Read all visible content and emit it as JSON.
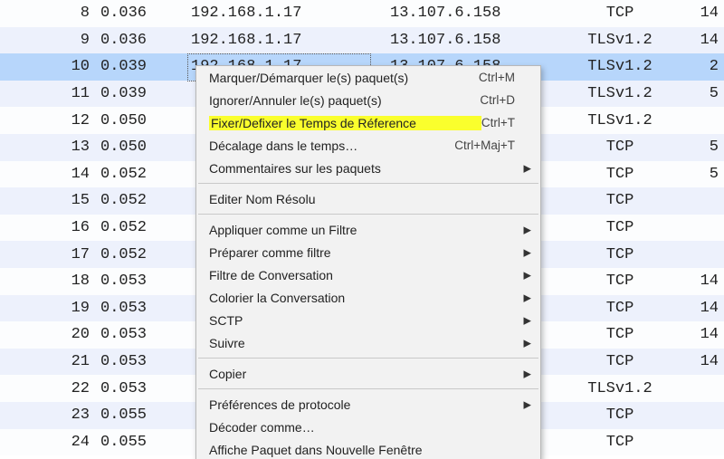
{
  "packets": [
    {
      "no": "8",
      "time": "0.036",
      "src": "192.168.1.17",
      "dst": "13.107.6.158",
      "proto": "TCP",
      "len": "14"
    },
    {
      "no": "9",
      "time": "0.036",
      "src": "192.168.1.17",
      "dst": "13.107.6.158",
      "proto": "TLSv1.2",
      "len": "14"
    },
    {
      "no": "10",
      "time": "0.039",
      "src": "192.168.1.17",
      "dst": "13.107.6.158",
      "proto": "TLSv1.2",
      "len": "2",
      "selected": true
    },
    {
      "no": "11",
      "time": "0.039",
      "src": "",
      "dst": "",
      "proto": "TLSv1.2",
      "len": "5"
    },
    {
      "no": "12",
      "time": "0.050",
      "src": "",
      "dst": "",
      "proto": "TLSv1.2",
      "len": ""
    },
    {
      "no": "13",
      "time": "0.050",
      "src": "",
      "dst": "",
      "proto": "TCP",
      "len": "5"
    },
    {
      "no": "14",
      "time": "0.052",
      "src": "",
      "dst": "",
      "proto": "TCP",
      "len": "5"
    },
    {
      "no": "15",
      "time": "0.052",
      "src": "",
      "dst": "",
      "proto": "TCP",
      "len": ""
    },
    {
      "no": "16",
      "time": "0.052",
      "src": "",
      "dst": "",
      "proto": "TCP",
      "len": ""
    },
    {
      "no": "17",
      "time": "0.052",
      "src": "",
      "dst": "",
      "proto": "TCP",
      "len": ""
    },
    {
      "no": "18",
      "time": "0.053",
      "src": "",
      "dst": "",
      "proto": "TCP",
      "len": "14"
    },
    {
      "no": "19",
      "time": "0.053",
      "src": "",
      "dst": "",
      "proto": "TCP",
      "len": "14"
    },
    {
      "no": "20",
      "time": "0.053",
      "src": "",
      "dst": "",
      "proto": "TCP",
      "len": "14"
    },
    {
      "no": "21",
      "time": "0.053",
      "src": "",
      "dst": "",
      "proto": "TCP",
      "len": "14"
    },
    {
      "no": "22",
      "time": "0.053",
      "src": "",
      "dst": "",
      "proto": "TLSv1.2",
      "len": ""
    },
    {
      "no": "23",
      "time": "0.055",
      "src": "",
      "dst": "",
      "proto": "TCP",
      "len": ""
    },
    {
      "no": "24",
      "time": "0.055",
      "src": "",
      "dst": "",
      "proto": "TCP",
      "len": ""
    }
  ],
  "menu": {
    "items": [
      {
        "label": "Marquer/Démarquer le(s) paquet(s)",
        "shortcut": "Ctrl+M"
      },
      {
        "label": "Ignorer/Annuler le(s) paquet(s)",
        "shortcut": "Ctrl+D"
      },
      {
        "label": "Fixer/Defixer le Temps de Réference",
        "shortcut": "Ctrl+T",
        "highlight": true
      },
      {
        "label": "Décalage dans le temps…",
        "shortcut": "Ctrl+Maj+T"
      },
      {
        "label": "Commentaires sur les paquets",
        "submenu": true
      },
      {
        "sep": true
      },
      {
        "label": "Editer Nom Résolu"
      },
      {
        "sep": true
      },
      {
        "label": "Appliquer comme un Filtre",
        "submenu": true
      },
      {
        "label": "Préparer comme filtre",
        "submenu": true
      },
      {
        "label": "Filtre de Conversation",
        "submenu": true
      },
      {
        "label": "Colorier la Conversation",
        "submenu": true
      },
      {
        "label": "SCTP",
        "submenu": true
      },
      {
        "label": "Suivre",
        "submenu": true
      },
      {
        "sep": true
      },
      {
        "label": "Copier",
        "submenu": true
      },
      {
        "sep": true
      },
      {
        "label": "Préférences de protocole",
        "submenu": true
      },
      {
        "label": "Décoder comme…"
      },
      {
        "label": "Affiche Paquet dans Nouvelle Fenêtre"
      }
    ]
  }
}
